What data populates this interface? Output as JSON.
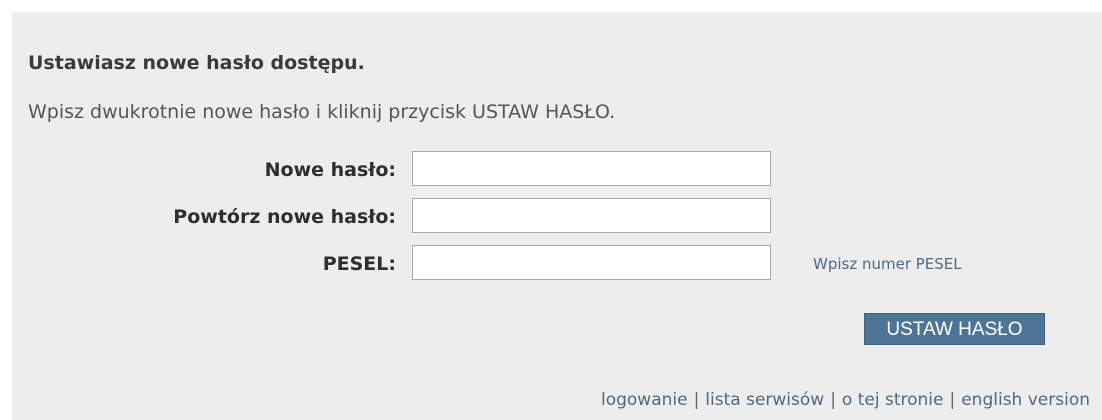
{
  "form": {
    "heading": "Ustawiasz nowe hasło dostępu.",
    "instructions": "Wpisz dwukrotnie nowe hasło i kliknij przycisk USTAW HASŁO.",
    "fields": [
      {
        "label": "Nowe hasło:",
        "value": "",
        "placeholder": ""
      },
      {
        "label": "Powtórz nowe hasło:",
        "value": "",
        "placeholder": ""
      },
      {
        "label": "PESEL:",
        "value": "",
        "placeholder": "",
        "hint": "Wpisz numer PESEL"
      }
    ],
    "submit_label": "USTAW HASŁO"
  },
  "footer": {
    "links": [
      "logowanie",
      "lista serwisów",
      "o tej stronie",
      "english version"
    ],
    "separator": "|"
  },
  "colors": {
    "panel_background": "#ededed",
    "button_background": "#4f7596",
    "link": "#4a6a88"
  }
}
